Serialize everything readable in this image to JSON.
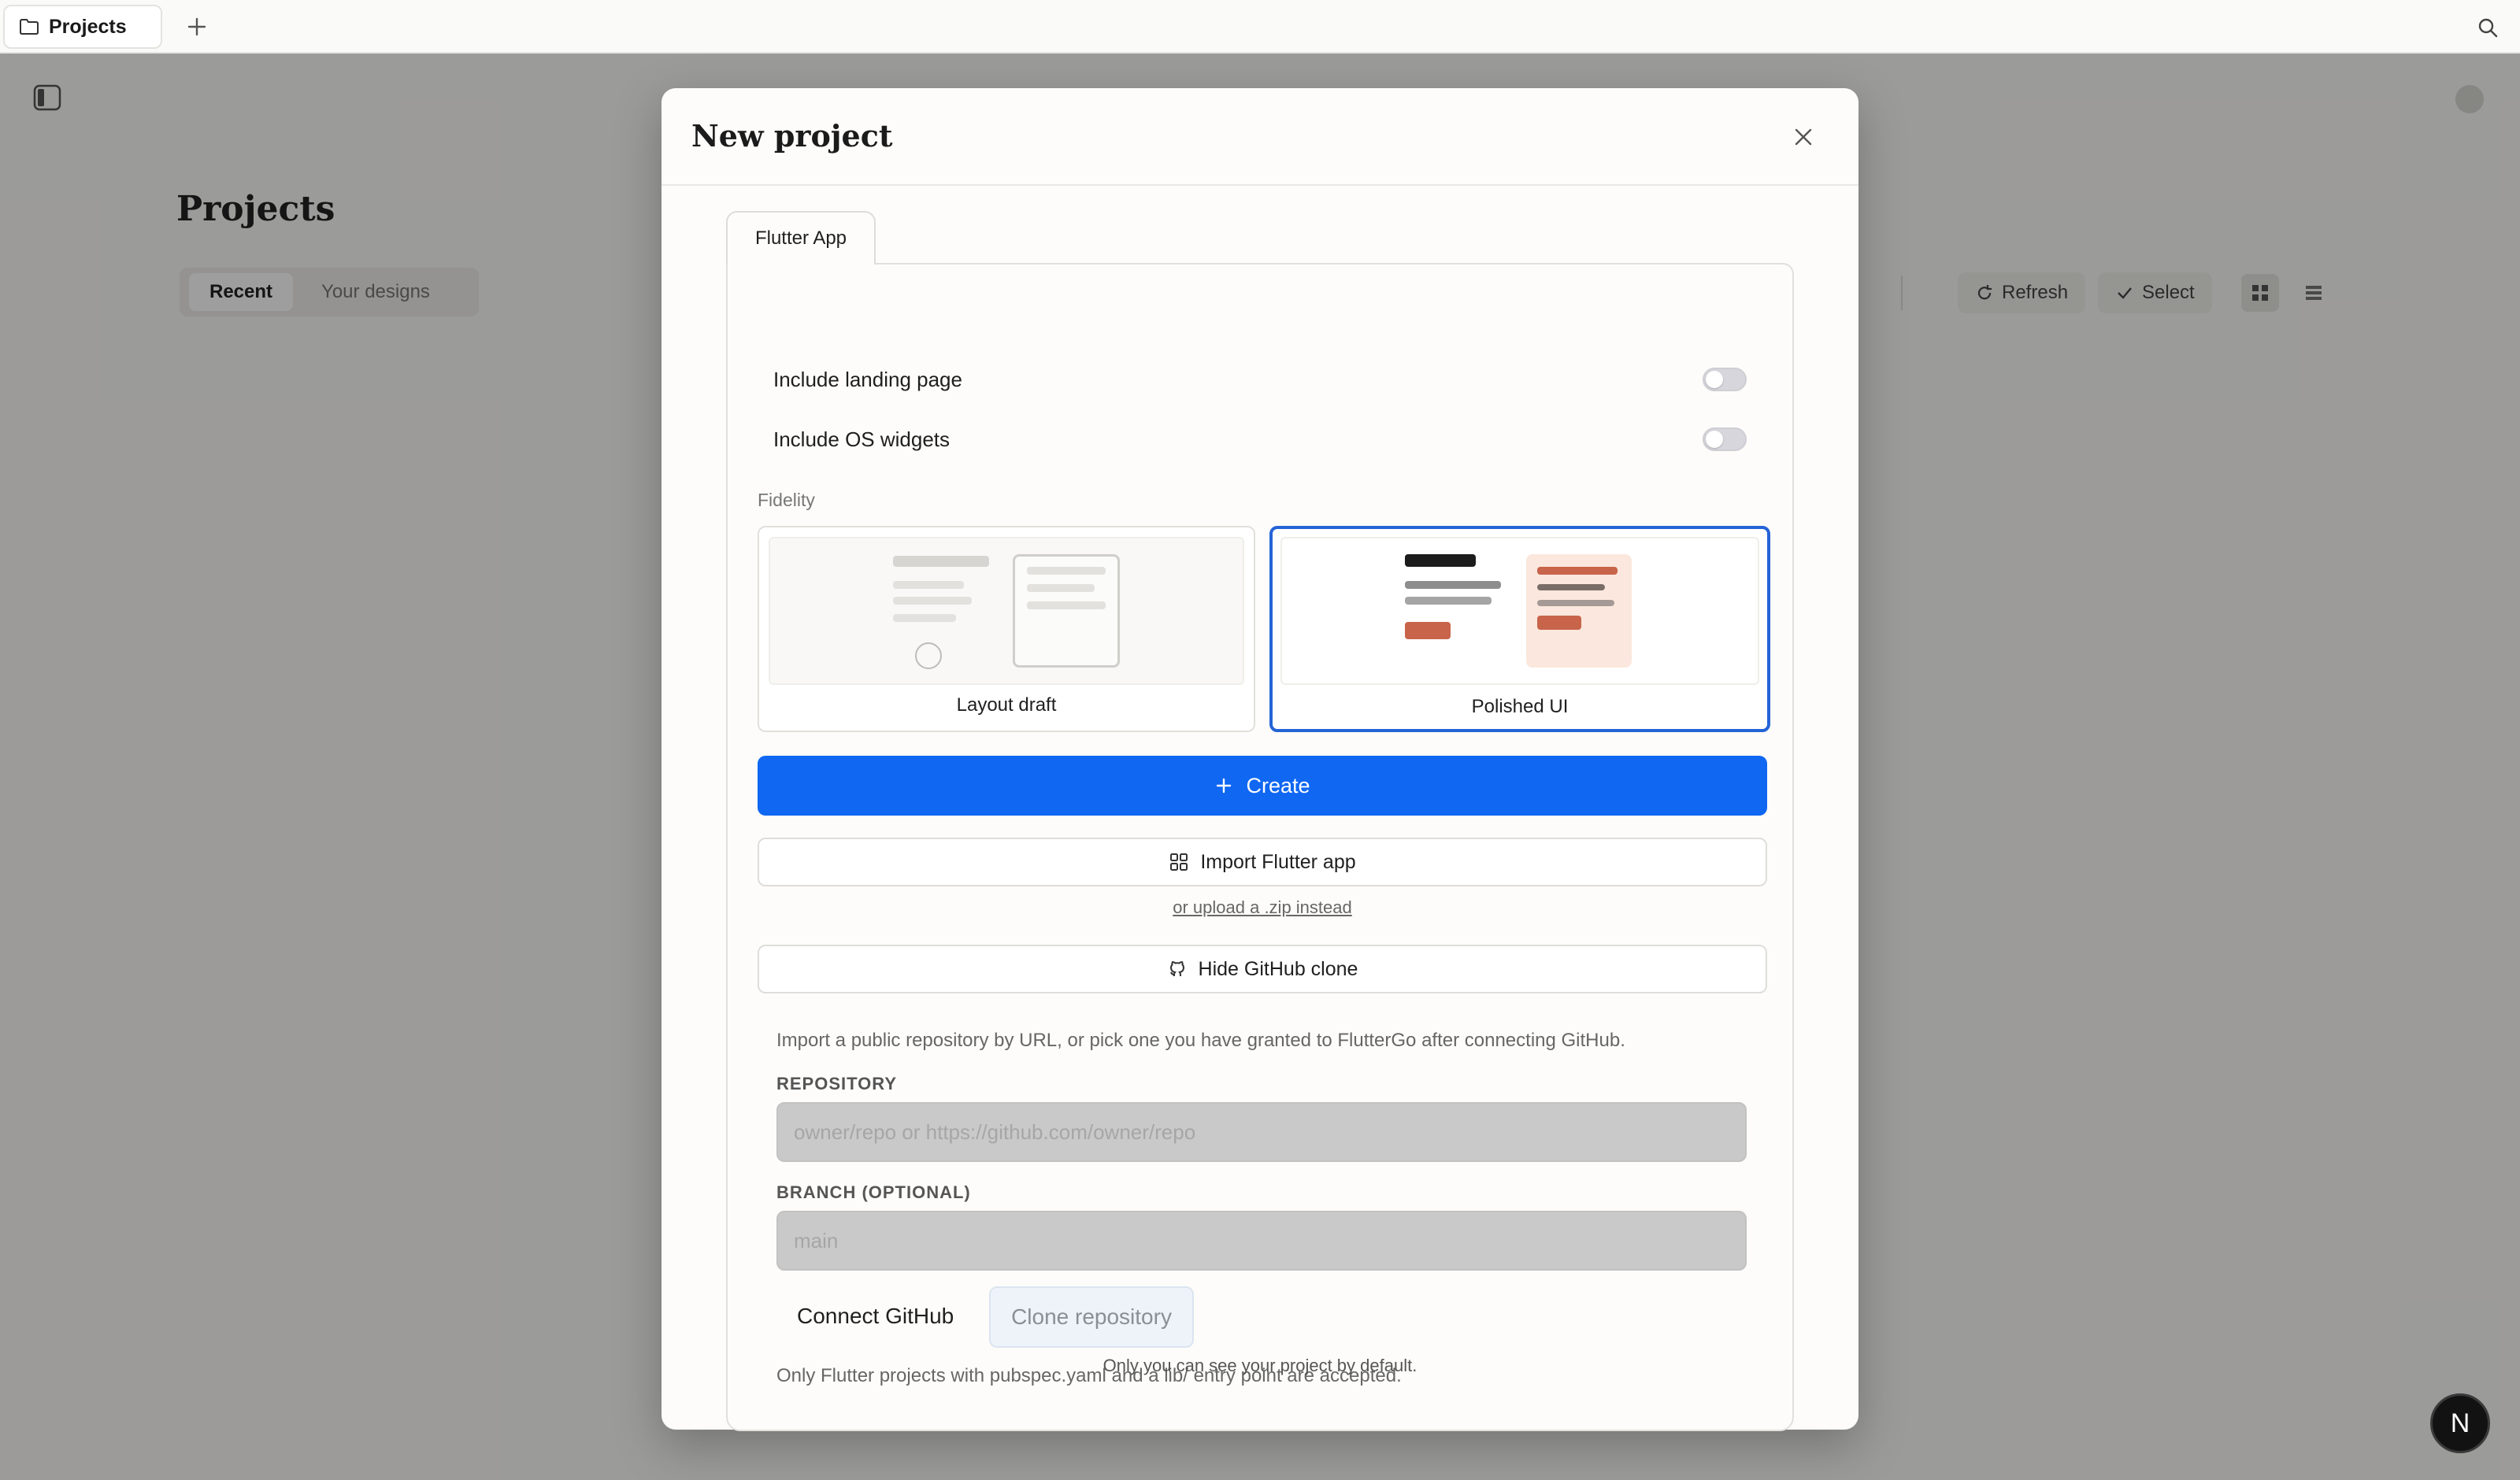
{
  "tabbar": {
    "tab_label": "Projects",
    "new_tab_icon": "plus-icon",
    "search_icon": "search-icon"
  },
  "background": {
    "page_title": "Projects",
    "segments": [
      "Recent",
      "Your designs"
    ],
    "refresh_label": "Refresh",
    "select_label": "Select"
  },
  "modal": {
    "title": "New project",
    "tab_label": "Flutter App",
    "toggles": [
      {
        "label": "Include landing page",
        "on": false
      },
      {
        "label": "Include OS widgets",
        "on": false
      }
    ],
    "fidelity_label": "Fidelity",
    "fidelity_options": [
      {
        "label": "Layout draft",
        "selected": false
      },
      {
        "label": "Polished UI",
        "selected": true
      }
    ],
    "create_label": "Create",
    "import_label": "Import Flutter app",
    "zip_link": "or upload a .zip instead",
    "github_toggle_label": "Hide GitHub clone",
    "github_description": "Import a public repository by URL, or pick one you have granted to FlutterGo after connecting GitHub.",
    "repository_label": "REPOSITORY",
    "repository_placeholder": "owner/repo or https://github.com/owner/repo",
    "branch_label": "BRANCH (OPTIONAL)",
    "branch_placeholder": "main",
    "connect_label": "Connect GitHub",
    "clone_label": "Clone repository",
    "note": "Only Flutter projects with pubspec.yaml and a lib/ entry point are accepted.",
    "visibility_note": "Only you can see your project by default."
  },
  "fab_label": "N",
  "colors": {
    "accent": "#0f67f2",
    "selected_border": "#2563d6",
    "preview_orange": "#c8644a",
    "preview_peach": "#fbe7dd"
  }
}
